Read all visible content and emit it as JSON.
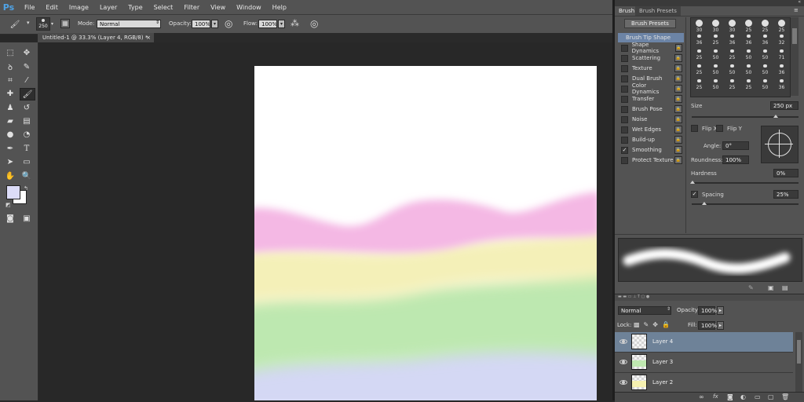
{
  "menu": [
    "File",
    "Edit",
    "Image",
    "Layer",
    "Type",
    "Select",
    "Filter",
    "View",
    "Window",
    "Help"
  ],
  "options_bar": {
    "brush_size": "250",
    "mode_label": "Mode:",
    "mode_value": "Normal",
    "opacity_label": "Opacity:",
    "opacity_value": "100%",
    "flow_label": "Flow:",
    "flow_value": "100%"
  },
  "document_tab": {
    "title": "Untitled-1 @ 33.3% (Layer 4, RGB/8) *",
    "close": "×"
  },
  "brush_panel": {
    "tab_brush": "Brush",
    "tab_presets": "Brush Presets",
    "presets_button": "Brush Presets",
    "tip_shape": "Brush Tip Shape",
    "options": [
      {
        "label": "Shape Dynamics",
        "checked": false
      },
      {
        "label": "Scattering",
        "checked": false
      },
      {
        "label": "Texture",
        "checked": false
      },
      {
        "label": "Dual Brush",
        "checked": false
      },
      {
        "label": "Color Dynamics",
        "checked": false
      },
      {
        "label": "Transfer",
        "checked": false
      },
      {
        "label": "Brush Pose",
        "checked": false
      },
      {
        "label": "Noise",
        "checked": false
      },
      {
        "label": "Wet Edges",
        "checked": false
      },
      {
        "label": "Build-up",
        "checked": false
      },
      {
        "label": "Smoothing",
        "checked": true
      },
      {
        "label": "Protect Texture",
        "checked": false
      }
    ],
    "tip_grid": [
      [
        "30",
        "30",
        "30",
        "25",
        "25",
        "25"
      ],
      [
        "36",
        "25",
        "36",
        "36",
        "36",
        "32"
      ],
      [
        "25",
        "50",
        "25",
        "50",
        "50",
        "71"
      ],
      [
        "25",
        "50",
        "50",
        "50",
        "50",
        "36"
      ],
      [
        "25",
        "50",
        "25",
        "25",
        "50",
        "36"
      ]
    ],
    "size_label": "Size",
    "size_value": "250 px",
    "flip_x": "Flip X",
    "flip_y": "Flip Y",
    "angle_label": "Angle:",
    "angle_value": "0°",
    "roundness_label": "Roundness:",
    "roundness_value": "100%",
    "hardness_label": "Hardness",
    "hardness_value": "0%",
    "spacing_label": "Spacing",
    "spacing_value": "25%"
  },
  "layers_panel": {
    "blend_mode": "Normal",
    "opacity_label": "Opacity:",
    "opacity_value": "100%",
    "lock_label": "Lock:",
    "fill_label": "Fill:",
    "fill_value": "100%",
    "layers": [
      {
        "name": "Layer 4",
        "active": true,
        "swatch": "#ffffff"
      },
      {
        "name": "Layer 3",
        "active": false,
        "swatch": "#bfe8b0"
      },
      {
        "name": "Layer 2",
        "active": false,
        "swatch": "#f5f0b0"
      }
    ]
  },
  "colors": {
    "foreground": "#dcdcf8",
    "background": "#ffffff",
    "band_pink": "#f4b8e4",
    "band_yellow": "#f4f0b8",
    "band_green": "#bde8b0",
    "band_lavender": "#d4d8f4",
    "selection_blue": "#6c84a6"
  }
}
